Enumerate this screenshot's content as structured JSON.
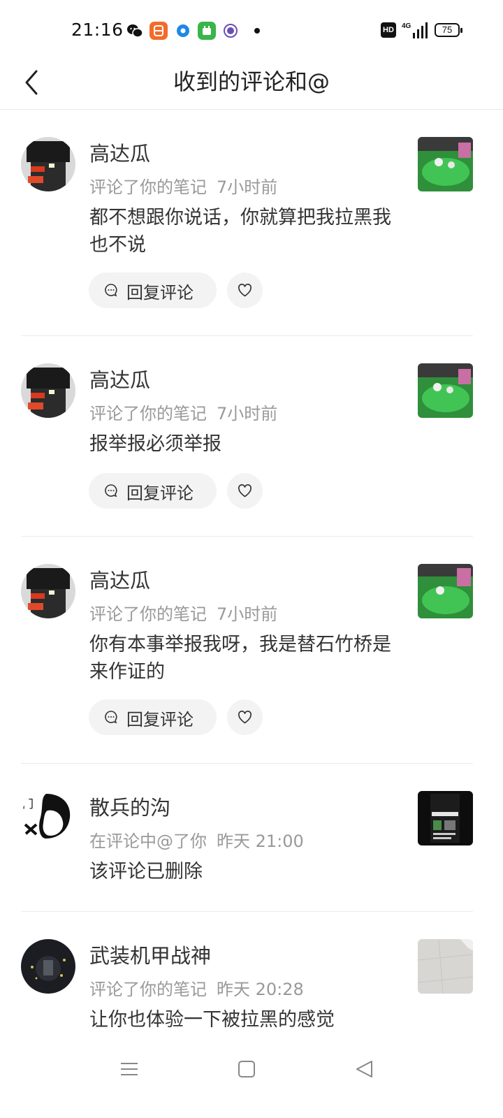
{
  "status_bar": {
    "time": "21:16",
    "hd_badge": "HD",
    "network": "4G",
    "battery": "75",
    "icons": [
      "wechat-icon",
      "app-icon",
      "app-icon",
      "app-icon",
      "app-icon"
    ]
  },
  "header": {
    "title": "收到的评论和@",
    "back_icon": "chevron-left-icon"
  },
  "reply_label": "回复评论",
  "notifications": [
    {
      "name": "高达瓜",
      "action": "评论了你的笔记",
      "time": "7小时前",
      "content": "都不想跟你说话，你就算把我拉黑我也不说"
    },
    {
      "name": "高达瓜",
      "action": "评论了你的笔记",
      "time": "7小时前",
      "content": "报举报必须举报"
    },
    {
      "name": "高达瓜",
      "action": "评论了你的笔记",
      "time": "7小时前",
      "content": "你有本事举报我呀，我是替石竹桥是来作证的"
    },
    {
      "name": "散兵的沟",
      "action": "在评论中@了你",
      "time": "昨天 21:00",
      "content": "该评论已删除"
    },
    {
      "name": "武装机甲战神",
      "action": "评论了你的笔记",
      "time": "昨天 20:28",
      "content": "让你也体验一下被拉黑的感觉"
    }
  ],
  "colors": {
    "text_primary": "#333333",
    "text_secondary": "#999999",
    "button_bg": "#f3f3f3",
    "divider": "#ebebeb"
  }
}
